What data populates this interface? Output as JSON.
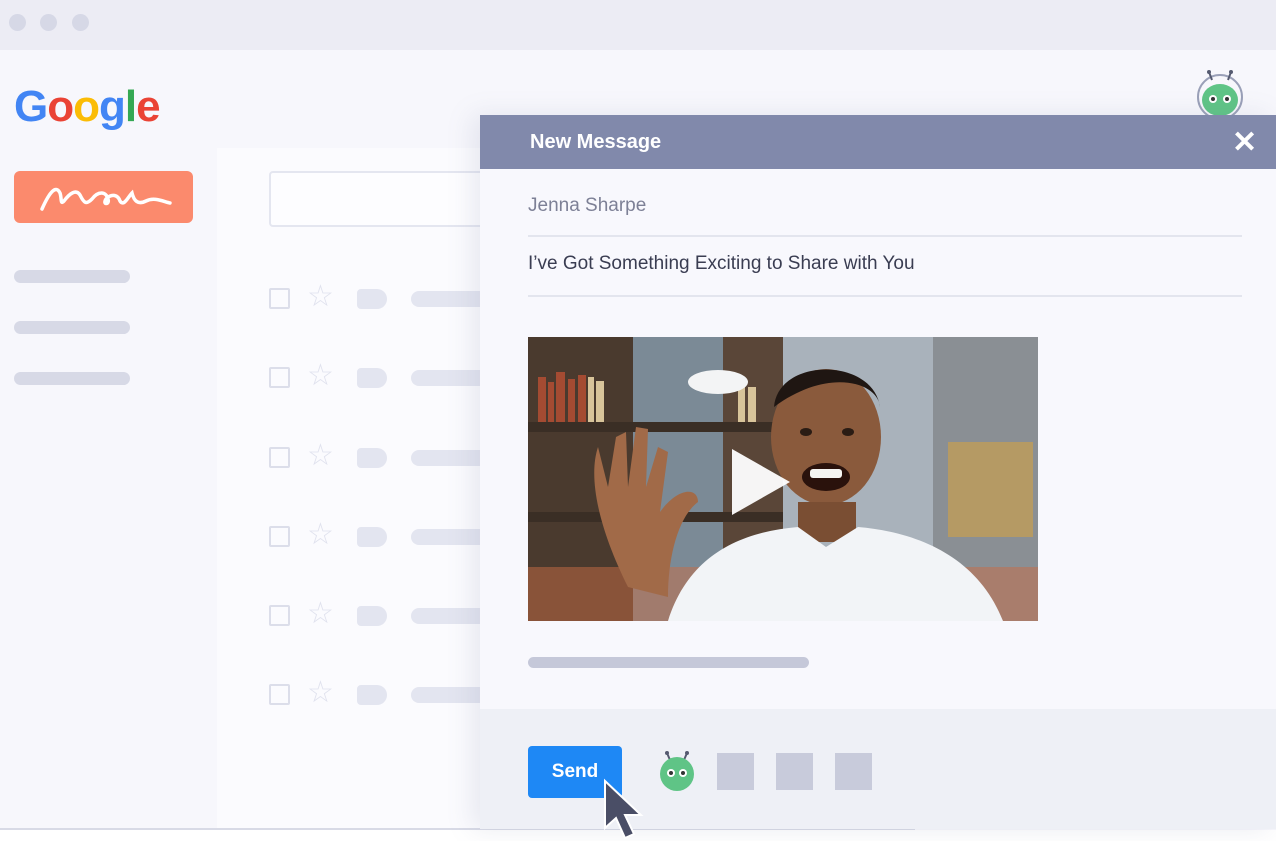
{
  "browser": {
    "window_controls": [
      "close",
      "minimize",
      "maximize"
    ]
  },
  "gmail": {
    "logo": "Google",
    "compose_icon": "signature-squiggle-icon",
    "inbox_rows": 6
  },
  "compose": {
    "title": "New Message",
    "close_label": "✕",
    "to": "Jenna Sharpe",
    "subject": "I’ve Got Something Exciting to Share with You",
    "video": {
      "description_icon": "play-icon"
    },
    "send_label": "Send",
    "toolbar_icons": [
      "robot-logo-icon",
      "toolbar-square-icon",
      "toolbar-square-icon",
      "toolbar-square-icon"
    ]
  },
  "colors": {
    "header": "#8189ab",
    "send": "#1e88f5",
    "compose_button": "#fb8a6d",
    "robot": "#5fc486",
    "accent_lines": "#5fd084"
  }
}
